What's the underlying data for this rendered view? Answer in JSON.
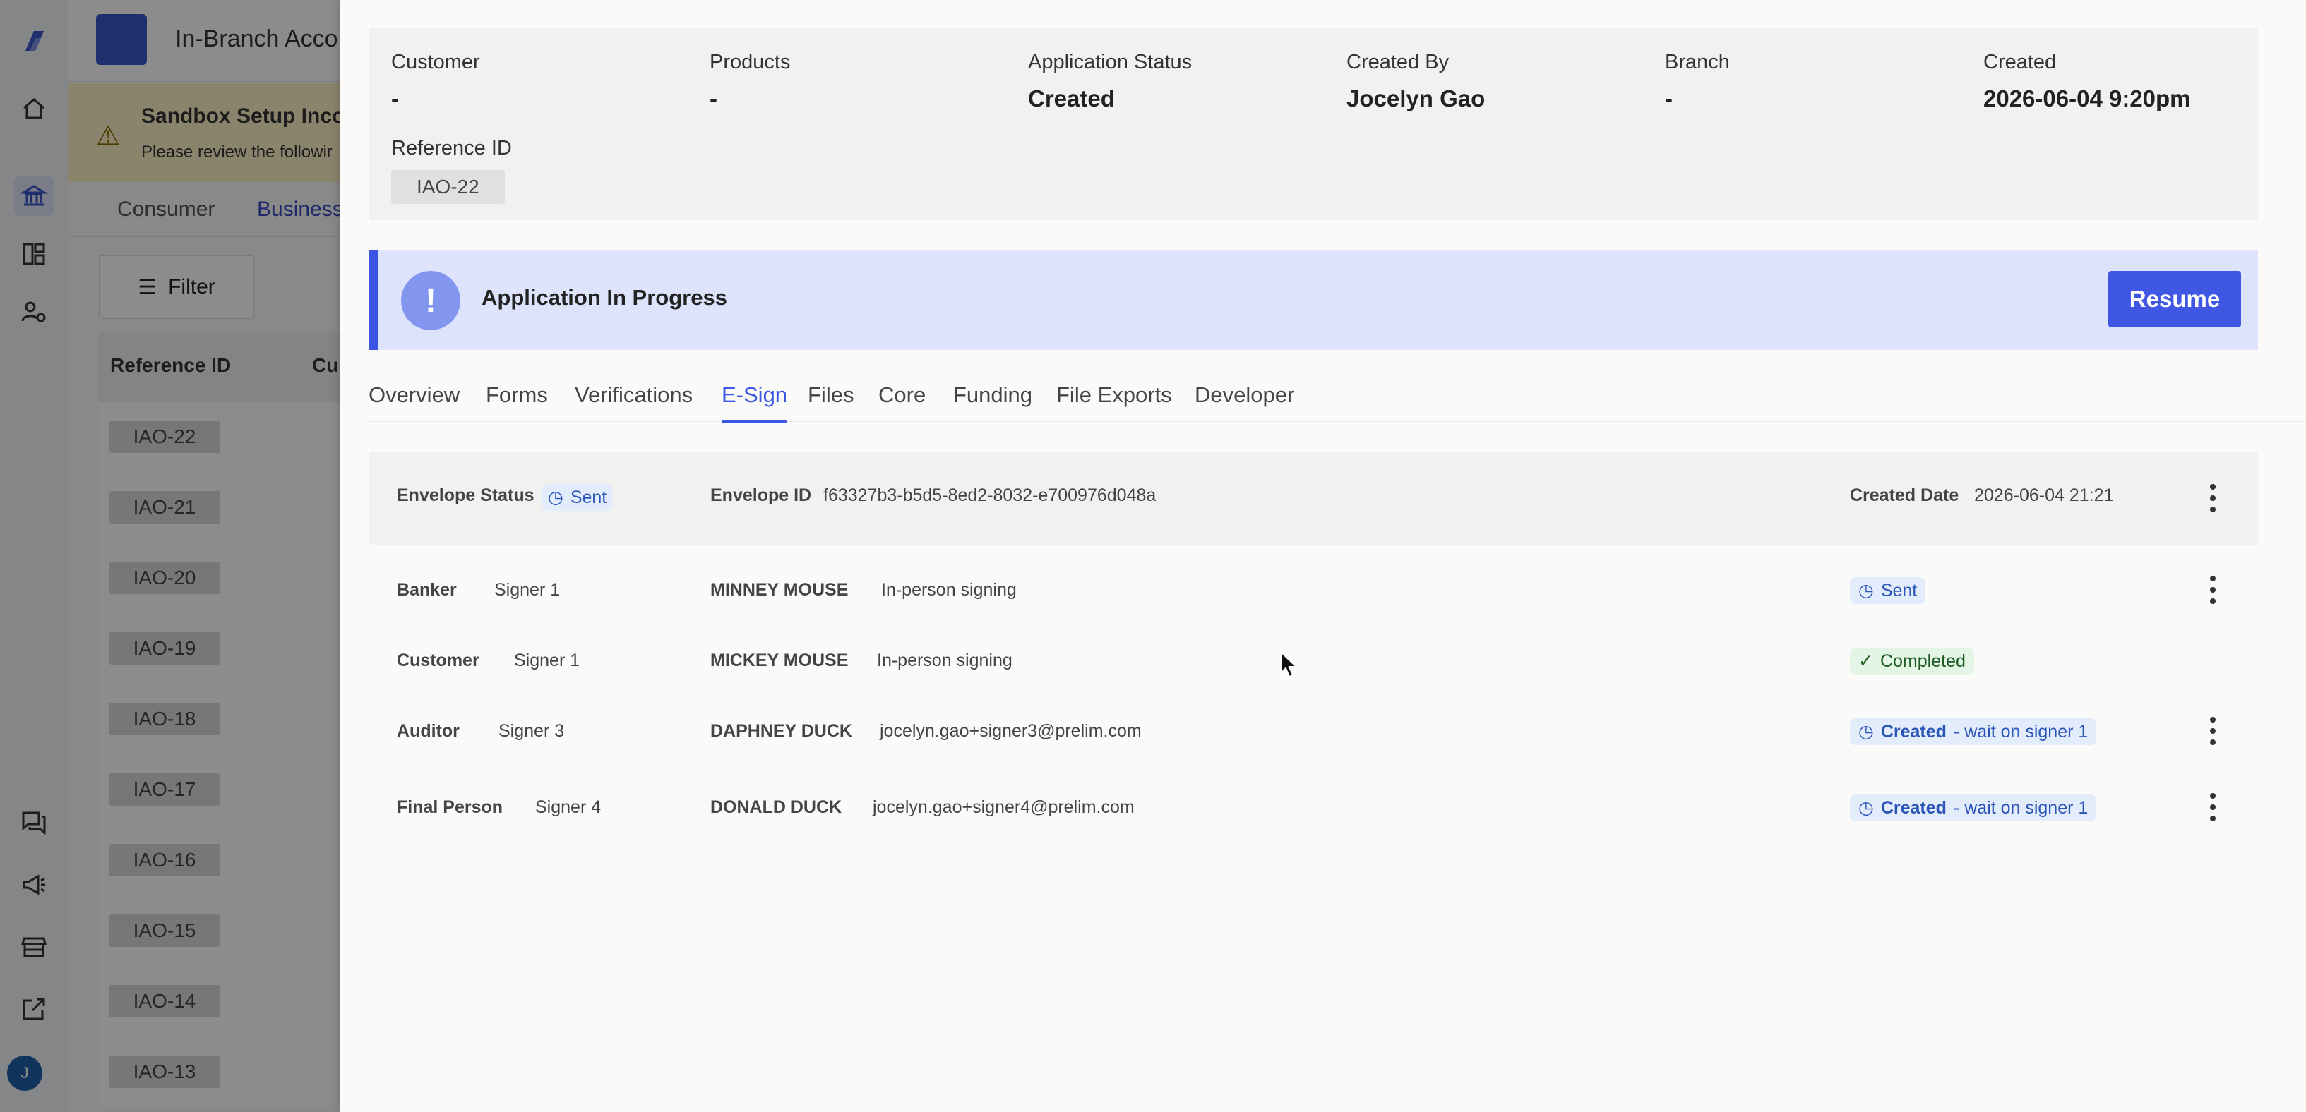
{
  "app": {
    "title": "In-Branch Acco",
    "user_initial": "J",
    "accent_color": "#3a55e4"
  },
  "rail": {
    "icons": [
      "logo-icon",
      "home-icon",
      "bank-icon",
      "dashboard-icon",
      "user-settings-icon",
      "chat-icon",
      "megaphone-icon",
      "store-icon",
      "external-link-icon"
    ]
  },
  "background": {
    "banner": {
      "title": "Sandbox Setup Incon",
      "text": "Please review the followir"
    },
    "tabs": [
      "Consumer",
      "Business"
    ],
    "filter_label": "Filter",
    "table": {
      "headers": [
        "Reference ID",
        "Cu"
      ],
      "rows": [
        "IAO-22",
        "IAO-21",
        "IAO-20",
        "IAO-19",
        "IAO-18",
        "IAO-17",
        "IAO-16",
        "IAO-15",
        "IAO-14",
        "IAO-13"
      ]
    }
  },
  "summary": {
    "customer": {
      "label": "Customer",
      "value": "-"
    },
    "products": {
      "label": "Products",
      "value": "-"
    },
    "status": {
      "label": "Application Status",
      "value": "Created"
    },
    "created_by": {
      "label": "Created By",
      "value": "Jocelyn Gao"
    },
    "branch": {
      "label": "Branch",
      "value": "-"
    },
    "created": {
      "label": "Created",
      "value": "2026-06-04 9:20pm"
    },
    "reference": {
      "label": "Reference ID",
      "value": "IAO-22"
    }
  },
  "progress": {
    "icon": "!",
    "text": "Application In Progress",
    "resume_label": "Resume"
  },
  "tabs": [
    "Overview",
    "Forms",
    "Verifications",
    "E-Sign",
    "Files",
    "Core",
    "Funding",
    "File Exports",
    "Developer"
  ],
  "active_tab": "E-Sign",
  "envelope": {
    "status_label": "Envelope Status",
    "status_value": "Sent",
    "id_label": "Envelope ID",
    "id_value": "f63327b3-b5d5-8ed2-8032-e700976d048a",
    "date_label": "Created Date",
    "date_value": "2026-06-04 21:21"
  },
  "signers": [
    {
      "role": "Banker",
      "signer": "Signer 1",
      "name": "MINNEY MOUSE",
      "detail": "In-person signing",
      "status": "Sent",
      "status_suffix": "",
      "status_type": "blue",
      "menu": true
    },
    {
      "role": "Customer",
      "signer": "Signer 1",
      "name": "MICKEY MOUSE",
      "detail": "In-person signing",
      "status": "Completed",
      "status_suffix": "",
      "status_type": "green",
      "menu": false
    },
    {
      "role": "Auditor",
      "signer": "Signer 3",
      "name": "DAPHNEY DUCK",
      "detail": "jocelyn.gao+signer3@prelim.com",
      "status": "Created",
      "status_suffix": "- wait on signer 1",
      "status_type": "blue",
      "menu": true
    },
    {
      "role": "Final Person",
      "signer": "Signer 4",
      "name": "DONALD DUCK",
      "detail": "jocelyn.gao+signer4@prelim.com",
      "status": "Created",
      "status_suffix": "- wait on signer 1",
      "status_type": "blue",
      "menu": true
    }
  ]
}
